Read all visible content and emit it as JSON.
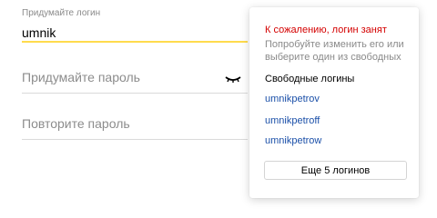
{
  "login_field": {
    "label": "Придумайте логин",
    "value": "umnik"
  },
  "password_field": {
    "placeholder": "Придумайте пароль",
    "toggle_icon": "eye-closed-icon"
  },
  "repeat_password_field": {
    "placeholder": "Повторите пароль"
  },
  "popup": {
    "title": "К сожалению, логин занят",
    "description": "Попробуйте изменить его или выберите один из свободных",
    "suggestions_title": "Свободные логины",
    "suggestions": [
      "umnikpetrov",
      "umnikpetroff",
      "umnikpetrow"
    ],
    "more_button": "Еще 5 логинов"
  },
  "colors": {
    "accent_underline": "#ffdb4d",
    "error_text": "#d40000",
    "link": "#1a4fa8"
  }
}
